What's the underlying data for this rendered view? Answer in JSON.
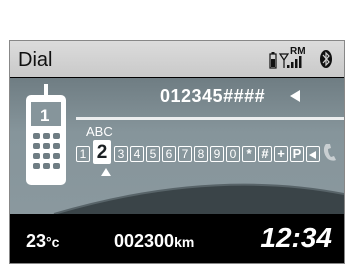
{
  "header": {
    "title": "Dial",
    "roam_label": "RM"
  },
  "dial": {
    "number": "012345####",
    "selected_group_label": "ABC",
    "keys": [
      "1",
      "2",
      "3",
      "4",
      "5",
      "6",
      "7",
      "8",
      "9",
      "0",
      "*",
      "#",
      "+",
      "P"
    ],
    "selected_key": "2",
    "phone_speed_label": "1"
  },
  "bottom": {
    "temperature": "23",
    "temperature_unit": "°c",
    "odometer": "002300",
    "odometer_unit": "km",
    "clock": "12:34"
  },
  "colors": {
    "header_bg": "#d2d2d2",
    "panel_bg": "#86959b",
    "bottom_bg": "#000000",
    "text": "#ffffff"
  },
  "icons": [
    "battery-icon",
    "signal-icon",
    "bluetooth-icon",
    "phone-icon",
    "call-icon",
    "backspace-icon",
    "pointer-icon"
  ]
}
